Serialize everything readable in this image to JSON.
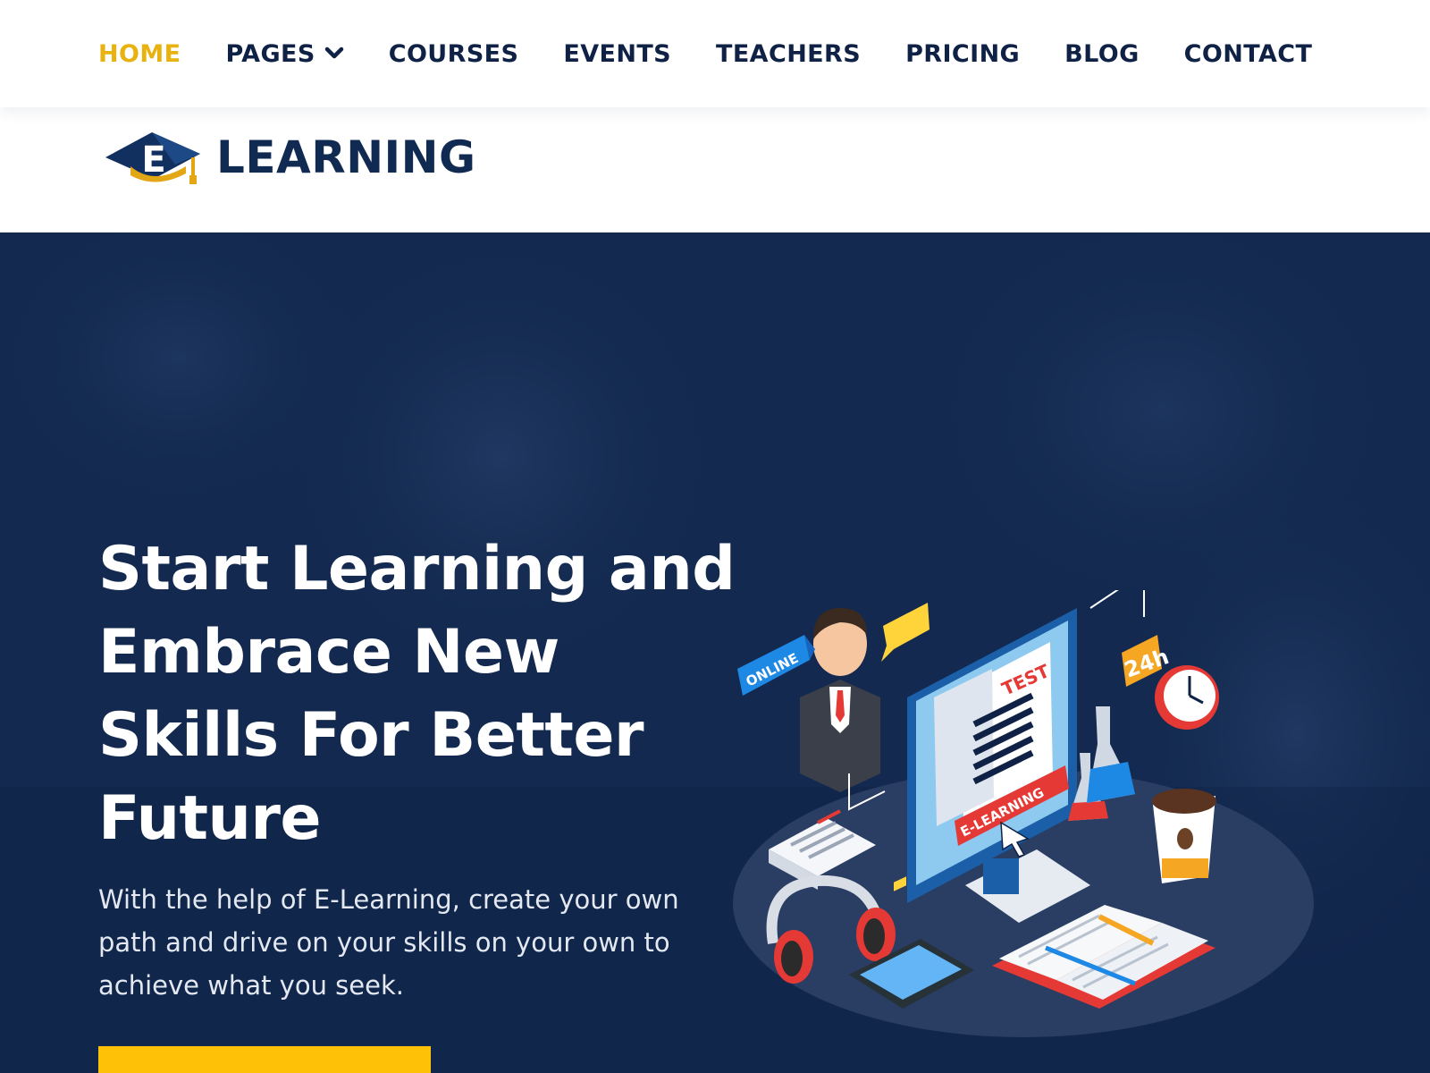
{
  "nav": {
    "items": [
      {
        "label": "HOME",
        "active": true
      },
      {
        "label": "PAGES",
        "has_dropdown": true
      },
      {
        "label": "COURSES"
      },
      {
        "label": "EVENTS"
      },
      {
        "label": "TEACHERS"
      },
      {
        "label": "PRICING"
      },
      {
        "label": "BLOG"
      },
      {
        "label": "CONTACT"
      }
    ]
  },
  "logo": {
    "mark_letter": "E",
    "text": "LEARNING"
  },
  "hero": {
    "title": "Start Learning and Embrace New Skills For Better Future",
    "description": "With the help of E-Learning, create your own path and drive on your skills on your own to achieve what you seek.",
    "cta_label": "",
    "illustration": {
      "online_label": "ONLINE",
      "test_label": "TEST",
      "elearning_label": "E-LEARNING",
      "hours_label": "24h"
    }
  },
  "colors": {
    "nav_text": "#0f2246",
    "nav_active": "#e8b310",
    "hero_bg": "#13294f",
    "accent": "#ffc107"
  },
  "icons": [
    "chevron-down-icon",
    "graduation-cap-icon"
  ]
}
